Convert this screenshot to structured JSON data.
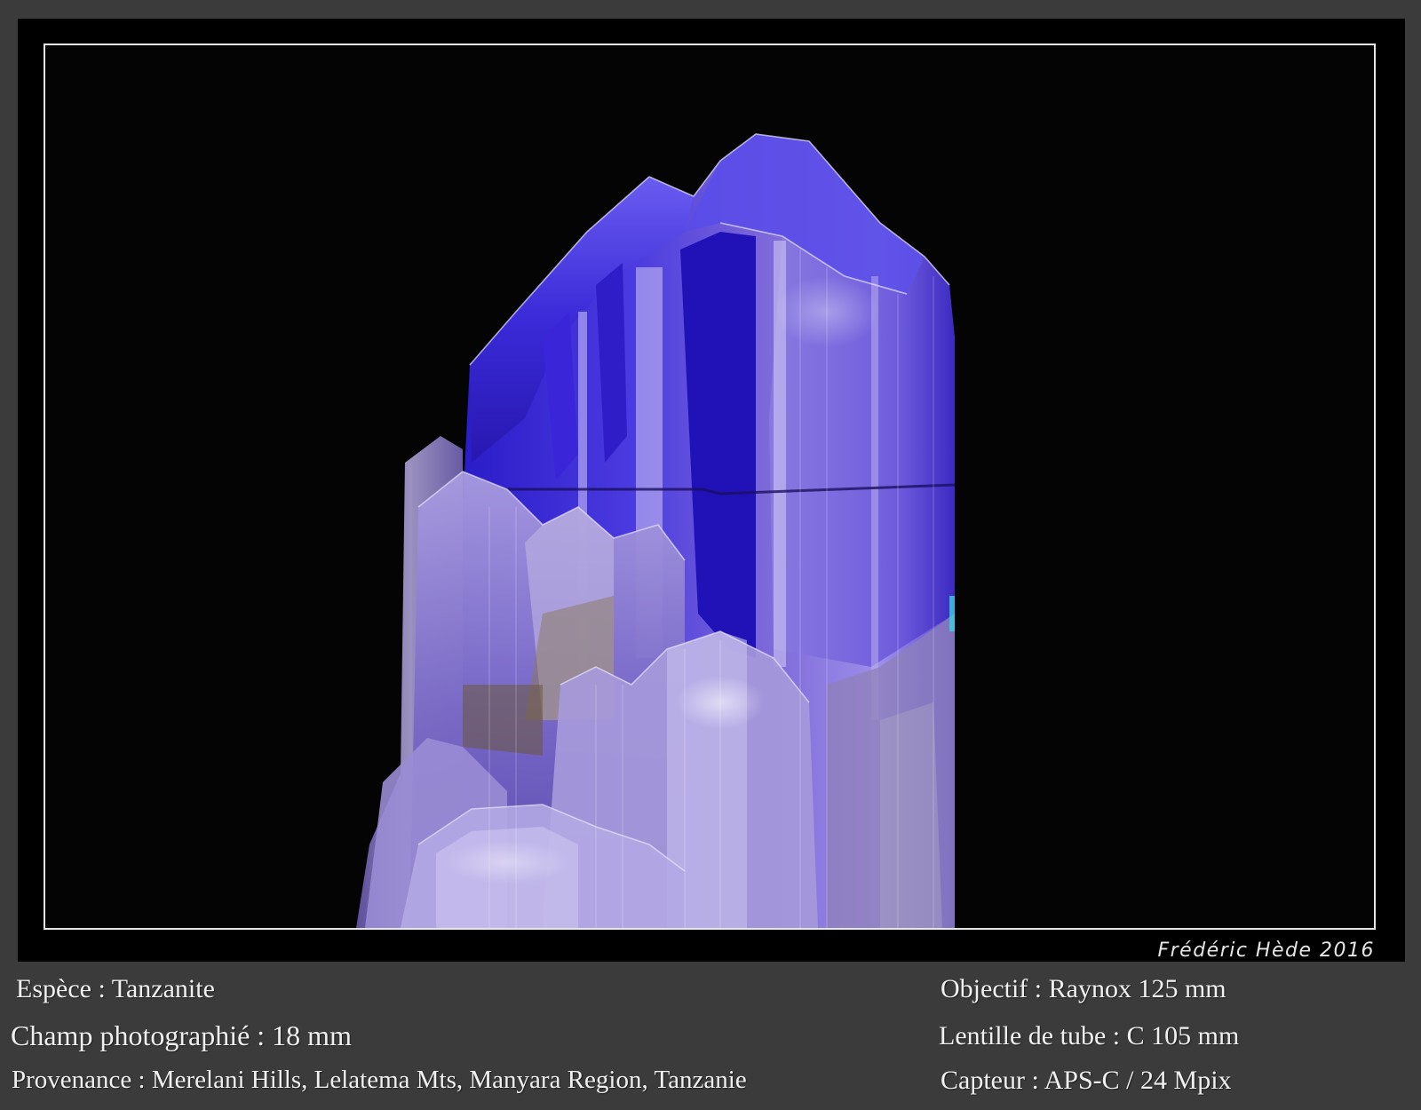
{
  "photo": {
    "signature": "Frédéric Hède 2016"
  },
  "caption": {
    "species": "Espèce : Tanzanite",
    "field": "Champ photographié : 18 mm",
    "origin": "Provenance : Merelani Hills, Lelatema Mts, Manyara Region, Tanzanie",
    "objective": "Objectif : Raynox 125 mm",
    "tube_lens": "Lentille de tube : C 105 mm",
    "sensor": "Capteur : APS-C / 24 Mpix"
  },
  "colors": {
    "page_background": "#3b3b3b",
    "photo_background": "#040405",
    "frame_border": "#e6e6e6",
    "crystal_deep_blue": "#2a1cc8",
    "crystal_violet": "#7a66d8",
    "crystal_highlight": "#d9d2f5",
    "caption_text": "#f0f0f0"
  }
}
